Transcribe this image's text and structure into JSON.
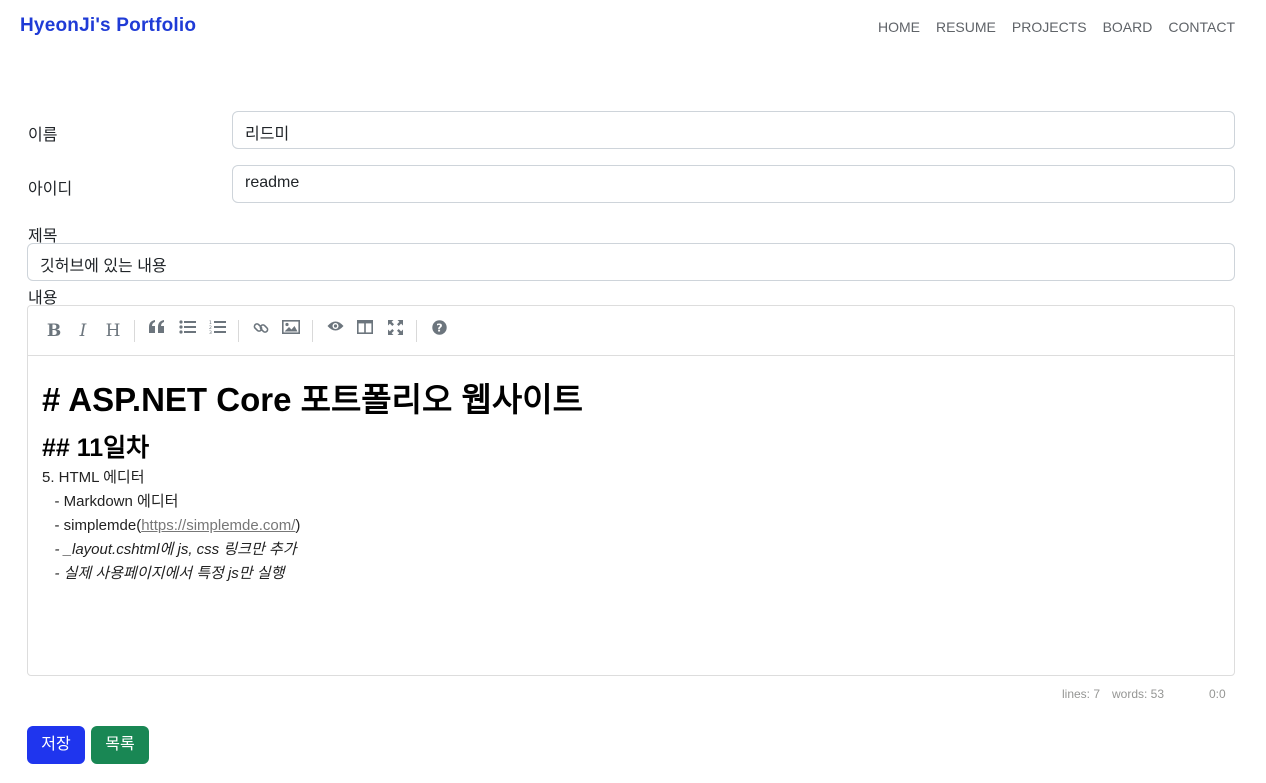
{
  "navbar": {
    "brand": "HyeonJi's Portfolio",
    "links": [
      "HOME",
      "RESUME",
      "PROJECTS",
      "BOARD",
      "CONTACT"
    ]
  },
  "form": {
    "name_label": "이름",
    "name_value": "리드미",
    "id_label": "아이디",
    "id_value": "readme",
    "title_label": "제목",
    "title_value": "깃허브에 있는 내용",
    "content_label": "내용"
  },
  "toolbar": {
    "icons": [
      "bold-icon",
      "italic-icon",
      "heading-icon",
      "quote-icon",
      "unordered-list-icon",
      "ordered-list-icon",
      "link-icon",
      "image-icon",
      "preview-icon",
      "side-by-side-icon",
      "fullscreen-icon",
      "help-icon"
    ]
  },
  "editor": {
    "h1": "# ASP.NET Core 포트폴리오 웹사이트",
    "h2": "## 11일차",
    "line1": "5. HTML 에디터",
    "line2": "   - Markdown 에디터",
    "line3_prefix": "   - simplemde(",
    "line3_link": "https://simplemde.com/",
    "line3_suffix": ")",
    "line4": "   - _layout.cshtml에 js, css 링크만 추가",
    "line5": "   - 실제 사용페이지에서 특정 js만 실행"
  },
  "statusbar": {
    "lines": "lines: 7",
    "words": "words: 53",
    "cursor": "0:0"
  },
  "buttons": {
    "save": "저장",
    "list": "목록"
  },
  "colors": {
    "brand": "#1f3bd6",
    "save_button": "#1f35ee",
    "list_button": "#198754"
  }
}
